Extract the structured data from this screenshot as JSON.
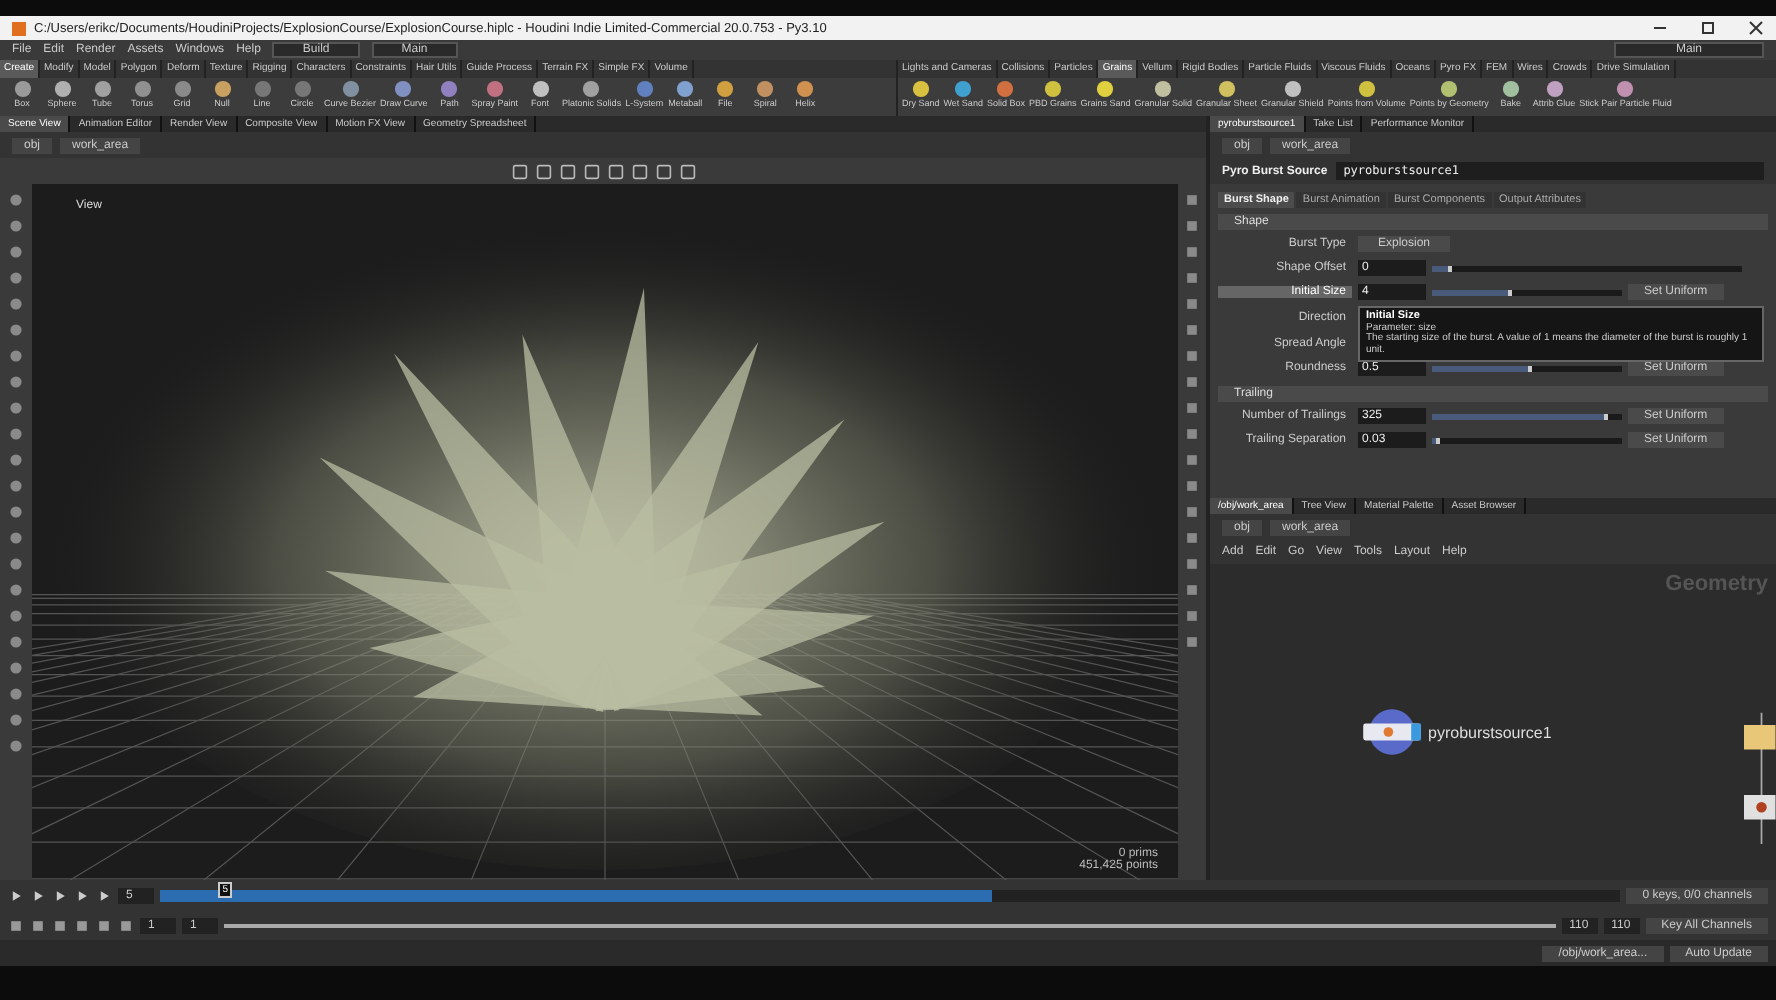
{
  "window": {
    "title": "C:/Users/erikc/Documents/HoudiniProjects/ExplosionCourse/ExplosionCourse.hiplc - Houdini Indie Limited-Commercial 20.0.753 - Py3.10"
  },
  "menu": [
    "File",
    "Edit",
    "Render",
    "Assets",
    "Windows",
    "Help"
  ],
  "desktop_left": "Build",
  "desktop_mid": "Main",
  "desktop_right": "Main",
  "shelf_left": {
    "tabs": [
      {
        "label": "Create",
        "selected": true
      },
      {
        "label": "Modify",
        "selected": false
      },
      {
        "label": "Model",
        "selected": false
      },
      {
        "label": "Polygon",
        "selected": false
      },
      {
        "label": "Deform",
        "selected": false
      },
      {
        "label": "Texture",
        "selected": false
      },
      {
        "label": "Rigging",
        "selected": false
      },
      {
        "label": "Characters",
        "selected": false
      },
      {
        "label": "Constraints",
        "selected": false
      },
      {
        "label": "Hair Utils",
        "selected": false
      },
      {
        "label": "Guide Process",
        "selected": false
      },
      {
        "label": "Terrain FX",
        "selected": false
      },
      {
        "label": "Simple FX",
        "selected": false
      },
      {
        "label": "Volume",
        "selected": false
      }
    ],
    "tools": [
      {
        "label": "Box",
        "color": "#9a9a9a"
      },
      {
        "label": "Sphere",
        "color": "#b0b0b0"
      },
      {
        "label": "Tube",
        "color": "#a0a0a0"
      },
      {
        "label": "Torus",
        "color": "#909090"
      },
      {
        "label": "Grid",
        "color": "#8a8a8a"
      },
      {
        "label": "Null",
        "color": "#c8a060"
      },
      {
        "label": "Line",
        "color": "#777777"
      },
      {
        "label": "Circle",
        "color": "#777777"
      },
      {
        "label": "Curve Bezier",
        "color": "#8090a0"
      },
      {
        "label": "Draw Curve",
        "color": "#8090c0"
      },
      {
        "label": "Path",
        "color": "#9080c0"
      },
      {
        "label": "Spray Paint",
        "color": "#c07080"
      },
      {
        "label": "Font",
        "color": "#c0c0c0"
      },
      {
        "label": "Platonic Solids",
        "color": "#a0a0a0"
      },
      {
        "label": "L-System",
        "color": "#6080c0"
      },
      {
        "label": "Metaball",
        "color": "#80a0d0"
      },
      {
        "label": "File",
        "color": "#d0a040"
      },
      {
        "label": "Spiral",
        "color": "#c09060"
      },
      {
        "label": "Helix",
        "color": "#d09050"
      }
    ]
  },
  "shelf_right": {
    "tabs": [
      {
        "label": "Lights and Cameras",
        "selected": false
      },
      {
        "label": "Collisions",
        "selected": false
      },
      {
        "label": "Particles",
        "selected": false
      },
      {
        "label": "Grains",
        "selected": true
      },
      {
        "label": "Vellum",
        "selected": false
      },
      {
        "label": "Rigid Bodies",
        "selected": false
      },
      {
        "label": "Particle Fluids",
        "selected": false
      },
      {
        "label": "Viscous Fluids",
        "selected": false
      },
      {
        "label": "Oceans",
        "selected": false
      },
      {
        "label": "Pyro FX",
        "selected": false
      },
      {
        "label": "FEM",
        "selected": false
      },
      {
        "label": "Wires",
        "selected": false
      },
      {
        "label": "Crowds",
        "selected": false
      },
      {
        "label": "Drive Simulation",
        "selected": false
      }
    ],
    "tools": [
      {
        "label": "Dry Sand",
        "color": "#d8c040"
      },
      {
        "label": "Wet Sand",
        "color": "#40a0d0"
      },
      {
        "label": "Solid Box",
        "color": "#d07040"
      },
      {
        "label": "PBD Grains",
        "color": "#d0c040"
      },
      {
        "label": "Grains Sand",
        "color": "#e0d040"
      },
      {
        "label": "Granular Solid",
        "color": "#c0c0a0"
      },
      {
        "label": "Granular Sheet",
        "color": "#d0c060"
      },
      {
        "label": "Granular Shield",
        "color": "#c0c0c0"
      },
      {
        "label": "Points from Volume",
        "color": "#d0c040"
      },
      {
        "label": "Points by Geometry",
        "color": "#b0c070"
      },
      {
        "label": "Bake",
        "color": "#a0c0a0"
      },
      {
        "label": "Attrib Glue",
        "color": "#c0a0c0"
      },
      {
        "label": "Stick Pair Particle Fluid",
        "color": "#c090b0"
      }
    ]
  },
  "scene_pane": {
    "tabs": [
      {
        "label": "Scene View",
        "selected": true
      },
      {
        "label": "Animation Editor",
        "selected": false
      },
      {
        "label": "Render View",
        "selected": false
      },
      {
        "label": "Composite View",
        "selected": false
      },
      {
        "label": "Motion FX View",
        "selected": false
      },
      {
        "label": "Geometry Spreadsheet",
        "selected": false
      }
    ],
    "path": [
      "obj",
      "work_area"
    ],
    "view_label": "View",
    "stats": [
      "0  prims",
      "451,425  points"
    ]
  },
  "param_pane": {
    "tabs": [
      {
        "label": "pyroburstsource1",
        "selected": true
      },
      {
        "label": "Take List",
        "selected": false
      },
      {
        "label": "Performance Monitor",
        "selected": false
      }
    ],
    "path": [
      "obj",
      "work_area"
    ],
    "node_type": "Pyro Burst Source",
    "node_name": "pyroburstsource1",
    "param_tabs": [
      {
        "label": "Burst Shape",
        "selected": true
      },
      {
        "label": "Burst Animation",
        "selected": false
      },
      {
        "label": "Burst Components",
        "selected": false
      },
      {
        "label": "Output Attributes",
        "selected": false
      }
    ],
    "sections": [
      {
        "title": "Shape",
        "rows": [
          {
            "kind": "menu",
            "label": "Burst Type",
            "value": "Explosion",
            "hovered": false
          },
          {
            "kind": "slider",
            "label": "Shape Offset",
            "value": "0",
            "level": 0.05,
            "hovered": false
          },
          {
            "kind": "slider",
            "label": "Initial Size",
            "value": "4",
            "level": 0.4,
            "hovered": true,
            "button": "Set Uniform"
          },
          {
            "kind": "label",
            "label": "Direction",
            "hovered": false
          },
          {
            "kind": "label",
            "label": "Spread Angle",
            "hovered": false
          },
          {
            "kind": "slider",
            "label": "Roundness",
            "value": "0.5",
            "level": 0.5,
            "hovered": false,
            "button": "Set Uniform"
          }
        ]
      },
      {
        "title": "Trailing",
        "rows": [
          {
            "kind": "slider",
            "label": "Number of Trailings",
            "value": "325",
            "level": 0.9,
            "hovered": false,
            "button": "Set Uniform"
          },
          {
            "kind": "slider",
            "label": "Trailing Separation",
            "value": "0.03",
            "level": 0.02,
            "hovered": false,
            "button": "Set Uniform"
          }
        ]
      }
    ],
    "tooltip": {
      "title": "Initial Size",
      "parameter": "Parameter: size",
      "text": "The starting size of the burst. A value of 1 means the diameter of the burst is roughly 1 unit."
    }
  },
  "network_pane": {
    "tabs": [
      {
        "label": "/obj/work_area",
        "selected": true
      },
      {
        "label": "Tree View",
        "selected": false
      },
      {
        "label": "Material Palette",
        "selected": false
      },
      {
        "label": "Asset Browser",
        "selected": false
      }
    ],
    "path": [
      "obj",
      "work_area"
    ],
    "menu": [
      "Add",
      "Edit",
      "Go",
      "View",
      "Tools",
      "Layout",
      "Help"
    ],
    "context": "Geometry",
    "node": "pyroburstsource1"
  },
  "timeline": {
    "frame": "5",
    "playhead": "5",
    "level": 0.04,
    "cache": {
      "level": 0.57
    },
    "range": {
      "level": 1
    },
    "range_start": "1",
    "range_in": "1",
    "range_out": "110",
    "end": "110",
    "keys": "0 keys, 0/0 channels",
    "key_all": "Key All Channels"
  },
  "status": {
    "path": "/obj/work_area...",
    "update": "Auto Update"
  }
}
